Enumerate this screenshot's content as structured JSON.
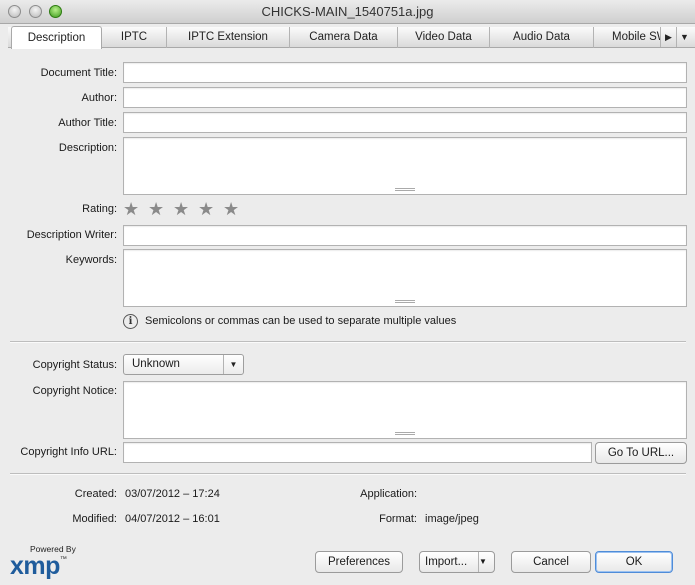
{
  "window": {
    "title": "CHICKS-MAIN_1540751a.jpg"
  },
  "tabs": [
    {
      "label": "Description",
      "active": true
    },
    {
      "label": "IPTC"
    },
    {
      "label": "IPTC Extension"
    },
    {
      "label": "Camera Data"
    },
    {
      "label": "Video Data"
    },
    {
      "label": "Audio Data"
    },
    {
      "label": "Mobile SW"
    }
  ],
  "tab_scroll": {
    "right_icon": "triangle-right-icon",
    "menu_icon": "triangle-down-icon"
  },
  "fields": {
    "document_title": {
      "label": "Document Title:",
      "value": ""
    },
    "author": {
      "label": "Author:",
      "value": ""
    },
    "author_title": {
      "label": "Author Title:",
      "value": ""
    },
    "description": {
      "label": "Description:",
      "value": ""
    },
    "rating": {
      "label": "Rating:",
      "value": 0,
      "max": 5
    },
    "description_writer": {
      "label": "Description Writer:",
      "value": ""
    },
    "keywords": {
      "label": "Keywords:",
      "value": ""
    },
    "keywords_hint": "Semicolons or commas can be used to separate multiple values",
    "copyright_status": {
      "label": "Copyright Status:",
      "value": "Unknown"
    },
    "copyright_notice": {
      "label": "Copyright Notice:",
      "value": ""
    },
    "copyright_url": {
      "label": "Copyright Info URL:",
      "value": "",
      "button": "Go To URL..."
    }
  },
  "metadata": {
    "created_label": "Created:",
    "created": "03/07/2012 – 17:24",
    "modified_label": "Modified:",
    "modified": "04/07/2012 – 16:01",
    "application_label": "Application:",
    "application": "",
    "format_label": "Format:",
    "format": "image/jpeg"
  },
  "footer": {
    "powered_by": "Powered By",
    "logo": "xmp",
    "logo_mark": "™",
    "preferences": "Preferences",
    "import": "Import...",
    "cancel": "Cancel",
    "ok": "OK"
  },
  "colors": {
    "accent": "#4f8cd8",
    "logo": "#1f5c9c",
    "star": "#8a8a8a"
  }
}
